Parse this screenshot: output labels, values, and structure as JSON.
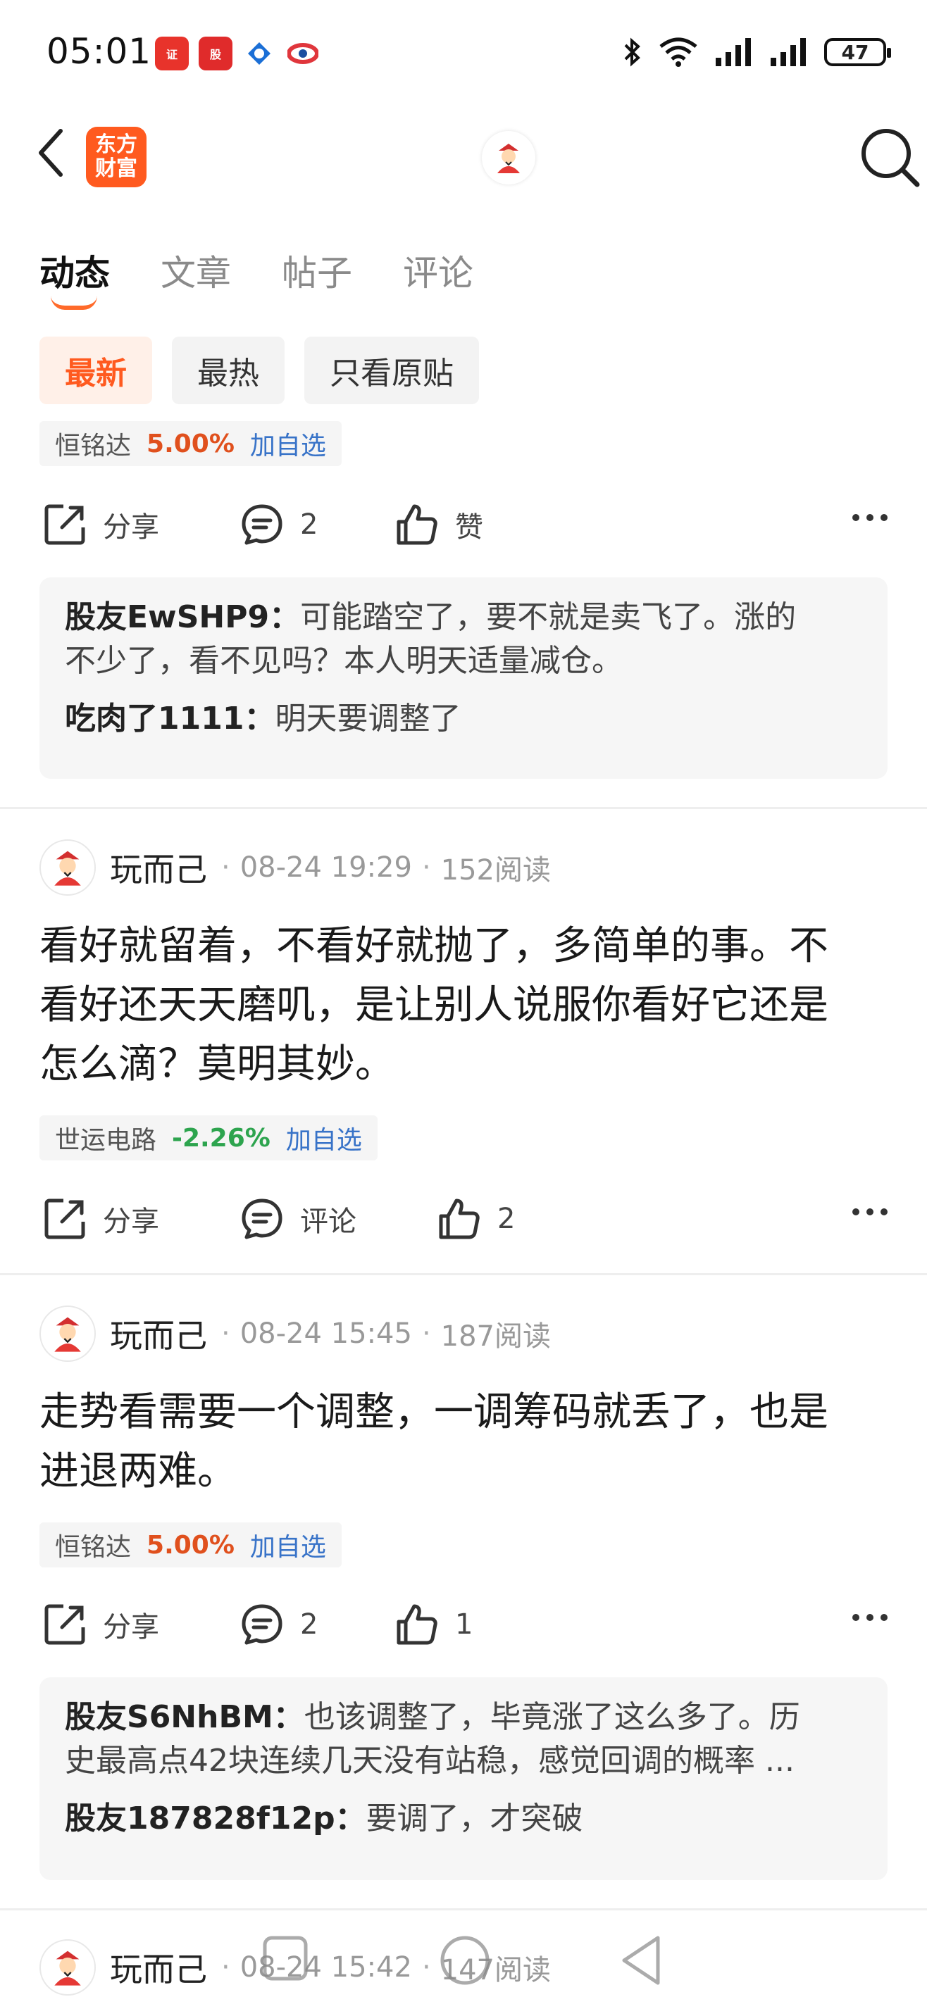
{
  "status_bar": {
    "time": "05:01",
    "battery": "47",
    "apps": [
      {
        "name": "方正证券",
        "color": "#e8332b"
      },
      {
        "name": "爱股票",
        "color": "#e02b2b"
      },
      {
        "name": "app3",
        "color": "#1b6fd6"
      },
      {
        "name": "app4",
        "color": "#e0363c"
      }
    ]
  },
  "header": {
    "logo_line1": "东方",
    "logo_line2": "财富"
  },
  "tabs": [
    "动态",
    "文章",
    "帖子",
    "评论"
  ],
  "filters": [
    "最新",
    "最热",
    "只看原贴"
  ],
  "post0": {
    "stock": {
      "name": "恒铭达",
      "pct": "5.00%",
      "add": "加自选"
    },
    "actions": {
      "share": "分享",
      "comment": "2",
      "like": "赞"
    },
    "comments": [
      {
        "user": "股友EwSHP9：",
        "text1": "可能踏空了，要不就是卖飞了。涨的",
        "text2": "不少了，看不见吗？本人明天适量减仓。"
      },
      {
        "user": "吃肉了1111：",
        "text1": "明天要调整了"
      }
    ]
  },
  "post1": {
    "author": "玩而己",
    "time": "08-24 19:29",
    "reads": "152阅读",
    "text": [
      "看好就留着，不看好就抛了，多简单的事。不",
      "看好还天天磨叽，是让别人说服你看好它还是",
      "怎么滴？莫明其妙。"
    ],
    "stock": {
      "name": "世运电路",
      "pct": "-2.26%",
      "add": "加自选"
    },
    "actions": {
      "share": "分享",
      "comment": "评论",
      "like": "2"
    }
  },
  "post2": {
    "author": "玩而己",
    "time": "08-24 15:45",
    "reads": "187阅读",
    "text": [
      "走势看需要一个调整，一调筹码就丢了，也是",
      "进退两难。"
    ],
    "stock": {
      "name": "恒铭达",
      "pct": "5.00%",
      "add": "加自选"
    },
    "actions": {
      "share": "分享",
      "comment": "2",
      "like": "1"
    },
    "comments": [
      {
        "user": "股友S6NhBM：",
        "text1": "也该调整了，毕竟涨了这么多了。历",
        "text2": "史最高点42块连续几天没有站稳，感觉回调的概率 ..."
      },
      {
        "user": "股友187828f12p：",
        "text1": "要调了，才突破"
      }
    ]
  },
  "post3": {
    "author": "玩而己",
    "time": "08-24 15:42",
    "reads": "147阅读"
  }
}
